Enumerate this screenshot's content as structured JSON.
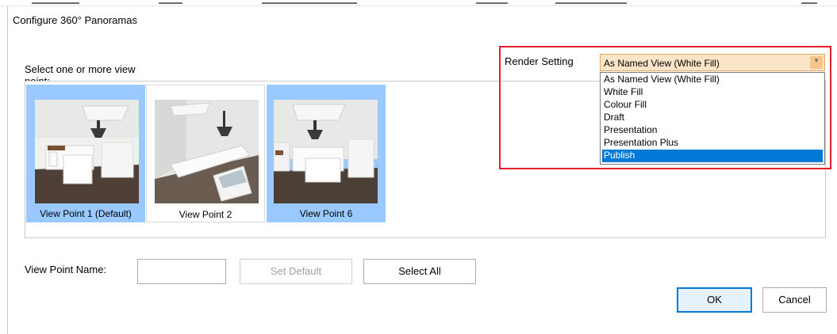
{
  "window": {
    "title": "Configure 360° Panoramas"
  },
  "viewpoints": {
    "prompt": "Select one or more view point:",
    "items": [
      {
        "label": "View Point 1 (Default)",
        "selected": true
      },
      {
        "label": "View Point 2",
        "selected": false
      },
      {
        "label": "View Point 6",
        "selected": true
      }
    ]
  },
  "render_setting": {
    "label": "Render Setting",
    "value": "As Named View (White Fill)",
    "options": [
      "As Named View (White Fill)",
      "White Fill",
      "Colour Fill",
      "Draft",
      "Presentation",
      "Presentation Plus",
      "Publish"
    ],
    "highlighted": "Publish"
  },
  "form": {
    "view_point_name_label": "View Point Name:",
    "view_point_name_value": "",
    "set_default_label": "Set Default",
    "select_all_label": "Select All"
  },
  "footer": {
    "ok_label": "OK",
    "cancel_label": "Cancel"
  },
  "colors": {
    "selection": "#99c9ff",
    "highlight": "#0078d7",
    "annotation": "#e0202a",
    "combo": "#fbe5c9"
  }
}
